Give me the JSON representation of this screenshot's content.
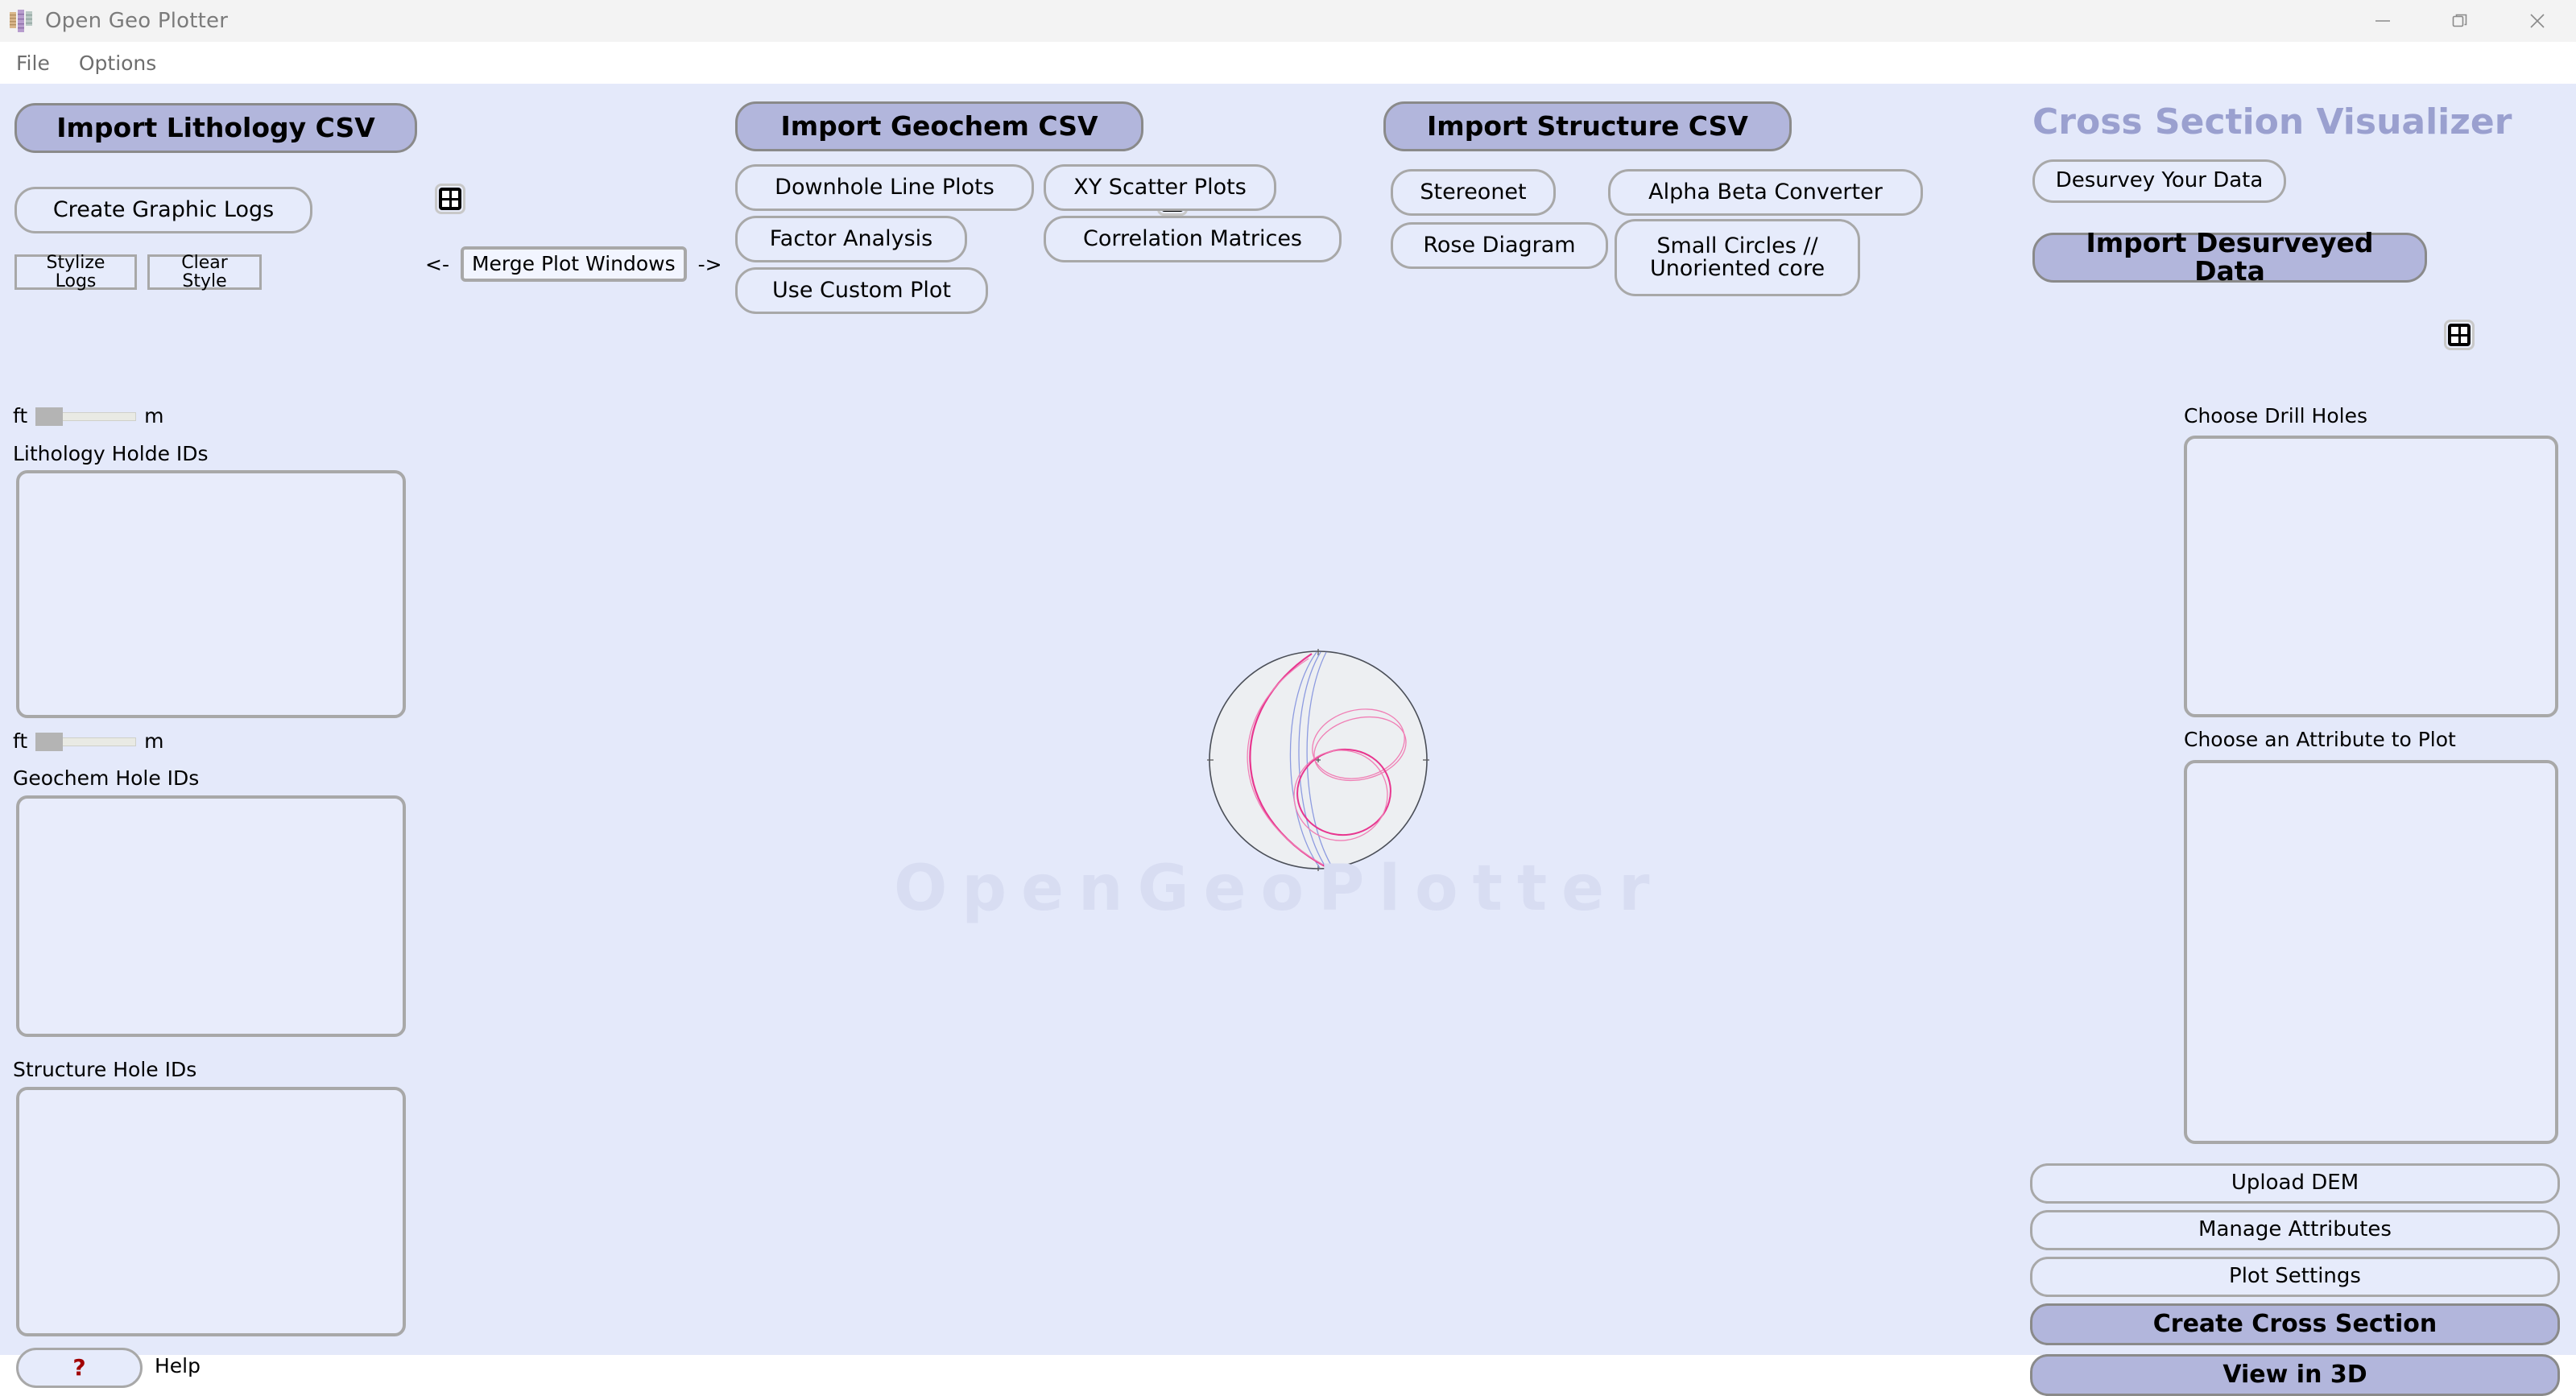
{
  "window": {
    "title": "Open Geo Plotter",
    "controls": {
      "minimize": "minimize-icon",
      "maximize": "maximize-icon",
      "close": "close-icon"
    }
  },
  "menubar": {
    "items": [
      {
        "label": "File"
      },
      {
        "label": "Options"
      }
    ]
  },
  "lithology_panel": {
    "import_button": "Import Lithology CSV",
    "table_icon": "table-grid-icon",
    "create_graphic_logs": "Create Graphic Logs",
    "stylize_logs": "Stylize Logs",
    "clear_style": "Clear Style",
    "unit_left": "ft",
    "unit_right": "m",
    "lithology_list_label": "Lithology Holde IDs",
    "geochem_list_label": "Geochem Hole IDs",
    "structure_list_label": "Structure Hole IDs",
    "help_button_glyph": "?",
    "help_label": "Help"
  },
  "merge": {
    "left_arrow": "<-",
    "button": "Merge Plot Windows",
    "right_arrow": "->"
  },
  "geochem_panel": {
    "import_button": "Import Geochem CSV",
    "table_icon": "table-grid-icon",
    "buttons": [
      "Downhole Line Plots",
      "XY Scatter Plots",
      "Factor Analysis",
      "Correlation Matrices",
      "Use Custom Plot"
    ]
  },
  "structure_panel": {
    "import_button": "Import Structure CSV",
    "table_icon": "table-grid-icon",
    "buttons": [
      "Stereonet",
      "Alpha Beta Converter",
      "Rose Diagram",
      "Small Circles //\nUnoriented core"
    ]
  },
  "cross_section_panel": {
    "title": "Cross Section Visualizer",
    "desurvey_button": "Desurvey Your Data",
    "import_button": "Import Desurveyed Data",
    "table_icon": "table-grid-icon",
    "drill_holes_label": "Choose Drill Holes",
    "attribute_label": "Choose an Attribute to Plot",
    "buttons": [
      "Upload DEM",
      "Manage Attributes",
      "Plot Settings"
    ],
    "accent_buttons": [
      "Create Cross Section",
      "View in 3D"
    ]
  },
  "canvas": {
    "watermark": "OpenGeoPlotter",
    "graphic": "stereonet-preview"
  },
  "colors": {
    "app_background": "#e4e9fa",
    "accent_button": "#b2b6dc",
    "title_accent": "#9aa0cf",
    "watermark": "#d8ddf2",
    "help_glyph": "#a10000",
    "border": "#a8a8a8"
  }
}
